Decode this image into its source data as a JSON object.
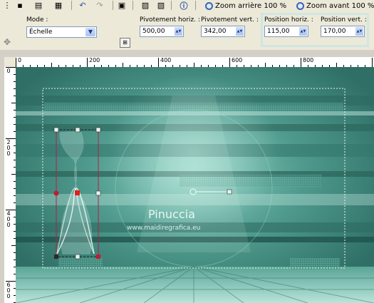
{
  "toolbar": {
    "zoom_out_label": "Zoom arrière 100 %",
    "zoom_in_label": "Zoom avant 100 %"
  },
  "options": {
    "mode_label": "Mode :",
    "mode_value": "Échelle",
    "pivot_h_label": "Pivotement horiz. :",
    "pivot_h_value": "500,00",
    "pivot_v_label": "Pivotement vert. :",
    "pivot_v_value": "342,00",
    "pos_h_label": "Position horiz. :",
    "pos_h_value": "115,00",
    "pos_v_label": "Position vert. :",
    "pos_v_value": "170,00"
  },
  "ruler": {
    "top_labels": [
      "0",
      "200",
      "400",
      "600",
      "800"
    ],
    "left_labels": [
      "0",
      "200",
      "400",
      "600"
    ]
  },
  "watermark": {
    "name": "Pinuccia",
    "url": "www.maidiregrafica.eu"
  },
  "colors": {
    "canvas_teal": "#3f8c80",
    "highlight": "#cfe6e4",
    "handle_red": "#e0201c"
  }
}
